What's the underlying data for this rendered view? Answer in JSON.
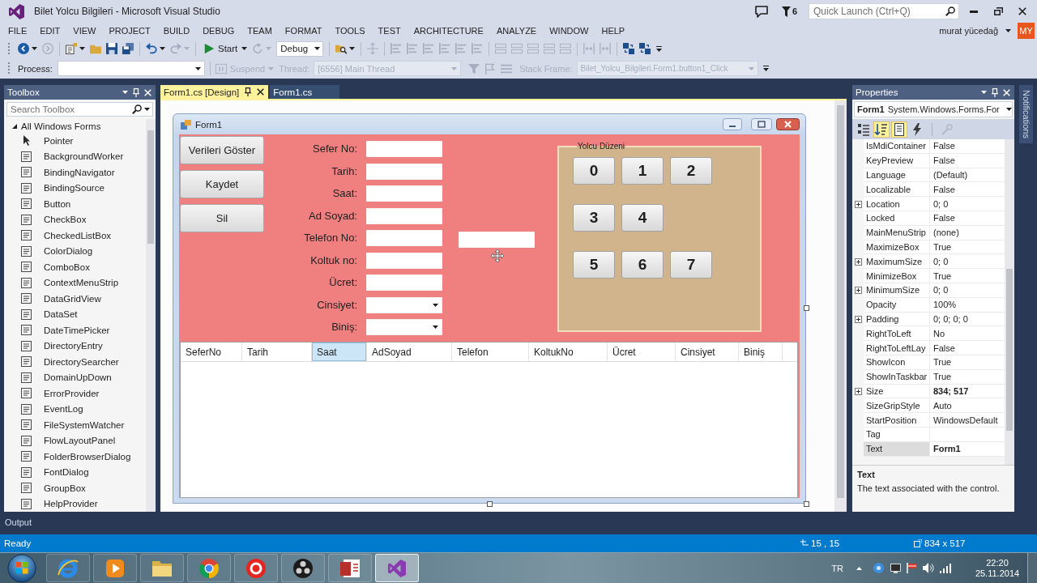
{
  "window": {
    "title": "Bilet Yolcu Bilgileri - Microsoft Visual Studio",
    "notifications_count": "6",
    "quick_launch": {
      "placeholder": "Quick Launch (Ctrl+Q)"
    }
  },
  "menu": [
    "FILE",
    "EDIT",
    "VIEW",
    "PROJECT",
    "BUILD",
    "DEBUG",
    "TEAM",
    "FORMAT",
    "TOOLS",
    "TEST",
    "ARCHITECTURE",
    "ANALYZE",
    "WINDOW",
    "HELP"
  ],
  "account": {
    "name": "murat yücedağ",
    "initials": "MY"
  },
  "toolbar": {
    "groups": [
      [
        {
          "kind": "back",
          "disabled": false,
          "menu": true
        },
        {
          "kind": "forward",
          "disabled": true,
          "menu": false
        }
      ],
      [
        {
          "kind": "new",
          "disabled": false,
          "menu": true
        },
        {
          "kind": "open",
          "disabled": false,
          "menu": false
        },
        {
          "kind": "save",
          "disabled": false,
          "menu": false
        },
        {
          "kind": "save_all",
          "disabled": false,
          "menu": false
        }
      ],
      [
        {
          "kind": "undo",
          "disabled": false,
          "menu": true
        },
        {
          "kind": "redo",
          "disabled": true,
          "menu": true
        }
      ],
      [
        {
          "kind": "start",
          "label": "Start",
          "disabled": false,
          "menu": true
        },
        {
          "kind": "attach",
          "disabled": true,
          "menu": true
        },
        {
          "kind": "config",
          "value": "Debug"
        }
      ],
      [
        {
          "kind": "find",
          "disabled": false,
          "menu": true
        }
      ],
      [
        {
          "kind": "grid",
          "disabled": true,
          "menu": false
        }
      ],
      [
        {
          "kind": "align",
          "disabled": true,
          "menu": false
        },
        {
          "kind": "align",
          "disabled": true,
          "menu": false
        },
        {
          "kind": "align",
          "disabled": true,
          "menu": false
        },
        {
          "kind": "align",
          "disabled": true,
          "menu": false
        },
        {
          "kind": "align",
          "disabled": true,
          "menu": false
        },
        {
          "kind": "align",
          "disabled": true,
          "menu": false
        }
      ],
      [
        {
          "kind": "size",
          "disabled": true,
          "menu": false
        },
        {
          "kind": "size",
          "disabled": true,
          "menu": false
        },
        {
          "kind": "size",
          "disabled": true,
          "menu": false
        },
        {
          "kind": "size",
          "disabled": true,
          "menu": false
        },
        {
          "kind": "size",
          "disabled": true,
          "menu": false
        }
      ],
      [
        {
          "kind": "space",
          "disabled": true,
          "menu": false
        },
        {
          "kind": "space",
          "disabled": true,
          "menu": false
        }
      ],
      [
        {
          "kind": "order",
          "disabled": false,
          "menu": false
        },
        {
          "kind": "order",
          "disabled": false,
          "menu": false
        }
      ]
    ]
  },
  "debug_location": {
    "process": {
      "label": "Process:"
    },
    "suspend": {
      "label": "Suspend",
      "disabled": true
    },
    "thread": {
      "label": "Thread:",
      "value": "[6556] Main Thread",
      "disabled": true
    },
    "tools": [
      {
        "kind": "filter",
        "disabled": true
      },
      {
        "kind": "flag",
        "disabled": true
      },
      {
        "kind": "stack",
        "disabled": true
      }
    ],
    "stack_frame": {
      "label": "Stack Frame:",
      "value": "Bilet_Yolcu_Bilgileri.Form1.button1_Click",
      "disabled": true
    }
  },
  "toolbox": {
    "title": "Toolbox",
    "search": {
      "placeholder": "Search Toolbox"
    },
    "category": {
      "label": "All Windows Forms",
      "expanded": true,
      "items": [
        "Pointer",
        "BackgroundWorker",
        "BindingNavigator",
        "BindingSource",
        "Button",
        "CheckBox",
        "CheckedListBox",
        "ColorDialog",
        "ComboBox",
        "ContextMenuStrip",
        "DataGridView",
        "DataSet",
        "DateTimePicker",
        "DirectoryEntry",
        "DirectorySearcher",
        "DomainUpDown",
        "ErrorProvider",
        "EventLog",
        "FileSystemWatcher",
        "FlowLayoutPanel",
        "FolderBrowserDialog",
        "FontDialog",
        "GroupBox",
        "HelpProvider"
      ]
    }
  },
  "document_tabs": [
    {
      "label": "Form1.cs [Design]",
      "selected": true
    },
    {
      "label": "Form1.cs",
      "selected": false
    }
  ],
  "form_designer": {
    "title": "Form1",
    "buttons": [
      "Verileri Göster",
      "Kaydet",
      "Sil"
    ],
    "fields": [
      {
        "label": "Sefer No:",
        "kind": "text"
      },
      {
        "label": "Tarih:",
        "kind": "text"
      },
      {
        "label": "Saat:",
        "kind": "text"
      },
      {
        "label": "Ad Soyad:",
        "kind": "text"
      },
      {
        "label": "Telefon No:",
        "kind": "text"
      },
      {
        "label": "Koltuk no:",
        "kind": "text"
      },
      {
        "label": "Ücret:",
        "kind": "text"
      },
      {
        "label": "Cinsiyet:",
        "kind": "combo"
      },
      {
        "label": "Biniş:",
        "kind": "combo"
      }
    ],
    "seat_group": {
      "title": "Yolcu Düzeni",
      "rows": [
        [
          "0",
          "1",
          "2"
        ],
        [
          "3",
          "4"
        ],
        [
          "5",
          "6",
          "7"
        ]
      ]
    },
    "grid": {
      "columns": [
        {
          "label": "SeferNo",
          "selected": false
        },
        {
          "label": "Tarih",
          "selected": false
        },
        {
          "label": "Saat",
          "selected": true
        },
        {
          "label": "AdSoyad",
          "selected": false
        },
        {
          "label": "Telefon",
          "selected": false
        },
        {
          "label": "KoltukNo",
          "selected": false
        },
        {
          "label": "Ücret",
          "selected": false
        },
        {
          "label": "Cinsiyet",
          "selected": false
        },
        {
          "label": "Biniş",
          "selected": false
        }
      ]
    }
  },
  "properties": {
    "title": "Properties",
    "object": {
      "name": "Form1",
      "type": "System.Windows.Forms.For"
    },
    "tools": [
      {
        "kind": "categorized",
        "selected": false,
        "disabled": false
      },
      {
        "kind": "alphabetical",
        "selected": true,
        "disabled": false
      },
      {
        "kind": "properties",
        "selected": true,
        "disabled": false
      },
      {
        "kind": "events",
        "selected": false,
        "disabled": false
      },
      {
        "kind": "pages",
        "selected": false,
        "disabled": true
      }
    ],
    "rows": [
      {
        "name": "IsMdiContainer",
        "value": "False",
        "expandable": false,
        "modified": false,
        "selected": false
      },
      {
        "name": "KeyPreview",
        "value": "False",
        "expandable": false,
        "modified": false,
        "selected": false
      },
      {
        "name": "Language",
        "value": "(Default)",
        "expandable": false,
        "modified": false,
        "selected": false
      },
      {
        "name": "Localizable",
        "value": "False",
        "expandable": false,
        "modified": false,
        "selected": false
      },
      {
        "name": "Location",
        "value": "0; 0",
        "expandable": true,
        "modified": false,
        "selected": false
      },
      {
        "name": "Locked",
        "value": "False",
        "expandable": false,
        "modified": false,
        "selected": false
      },
      {
        "name": "MainMenuStrip",
        "value": "(none)",
        "expandable": false,
        "modified": false,
        "selected": false
      },
      {
        "name": "MaximizeBox",
        "value": "True",
        "expandable": false,
        "modified": false,
        "selected": false
      },
      {
        "name": "MaximumSize",
        "value": "0; 0",
        "expandable": true,
        "modified": false,
        "selected": false
      },
      {
        "name": "MinimizeBox",
        "value": "True",
        "expandable": false,
        "modified": false,
        "selected": false
      },
      {
        "name": "MinimumSize",
        "value": "0; 0",
        "expandable": true,
        "modified": false,
        "selected": false
      },
      {
        "name": "Opacity",
        "value": "100%",
        "expandable": false,
        "modified": false,
        "selected": false
      },
      {
        "name": "Padding",
        "value": "0; 0; 0; 0",
        "expandable": true,
        "modified": false,
        "selected": false
      },
      {
        "name": "RightToLeft",
        "value": "No",
        "expandable": false,
        "modified": false,
        "selected": false
      },
      {
        "name": "RightToLeftLay",
        "value": "False",
        "expandable": false,
        "modified": false,
        "selected": false
      },
      {
        "name": "ShowIcon",
        "value": "True",
        "expandable": false,
        "modified": false,
        "selected": false
      },
      {
        "name": "ShowInTaskbar",
        "value": "True",
        "expandable": false,
        "modified": false,
        "selected": false
      },
      {
        "name": "Size",
        "value": "834; 517",
        "expandable": true,
        "modified": true,
        "selected": false
      },
      {
        "name": "SizeGripStyle",
        "value": "Auto",
        "expandable": false,
        "modified": false,
        "selected": false
      },
      {
        "name": "StartPosition",
        "value": "WindowsDefault",
        "expandable": false,
        "modified": false,
        "selected": false
      },
      {
        "name": "Tag",
        "expandable": false,
        "selected": false
      },
      {
        "name": "Text",
        "value": "Form1",
        "expandable": false,
        "modified": true,
        "selected": true
      }
    ],
    "description": {
      "title": "Text",
      "text": "The text associated with the control."
    }
  },
  "notifications_tab": "Notifications",
  "output_tab": "Output",
  "status_bar": {
    "text": "Ready",
    "cursor_position": "15 , 15",
    "selection_size": "834 x 517"
  },
  "taskbar": {
    "apps": [
      {
        "kind": "ie",
        "active": false
      },
      {
        "kind": "media",
        "active": false
      },
      {
        "kind": "folder",
        "active": false
      },
      {
        "kind": "chrome",
        "active": false
      },
      {
        "kind": "yandex",
        "active": false
      },
      {
        "kind": "obs",
        "active": false
      },
      {
        "kind": "access",
        "active": false
      },
      {
        "kind": "vs",
        "active": true
      }
    ],
    "language": "TR",
    "time": "22:20",
    "date": "25.11.2014"
  }
}
